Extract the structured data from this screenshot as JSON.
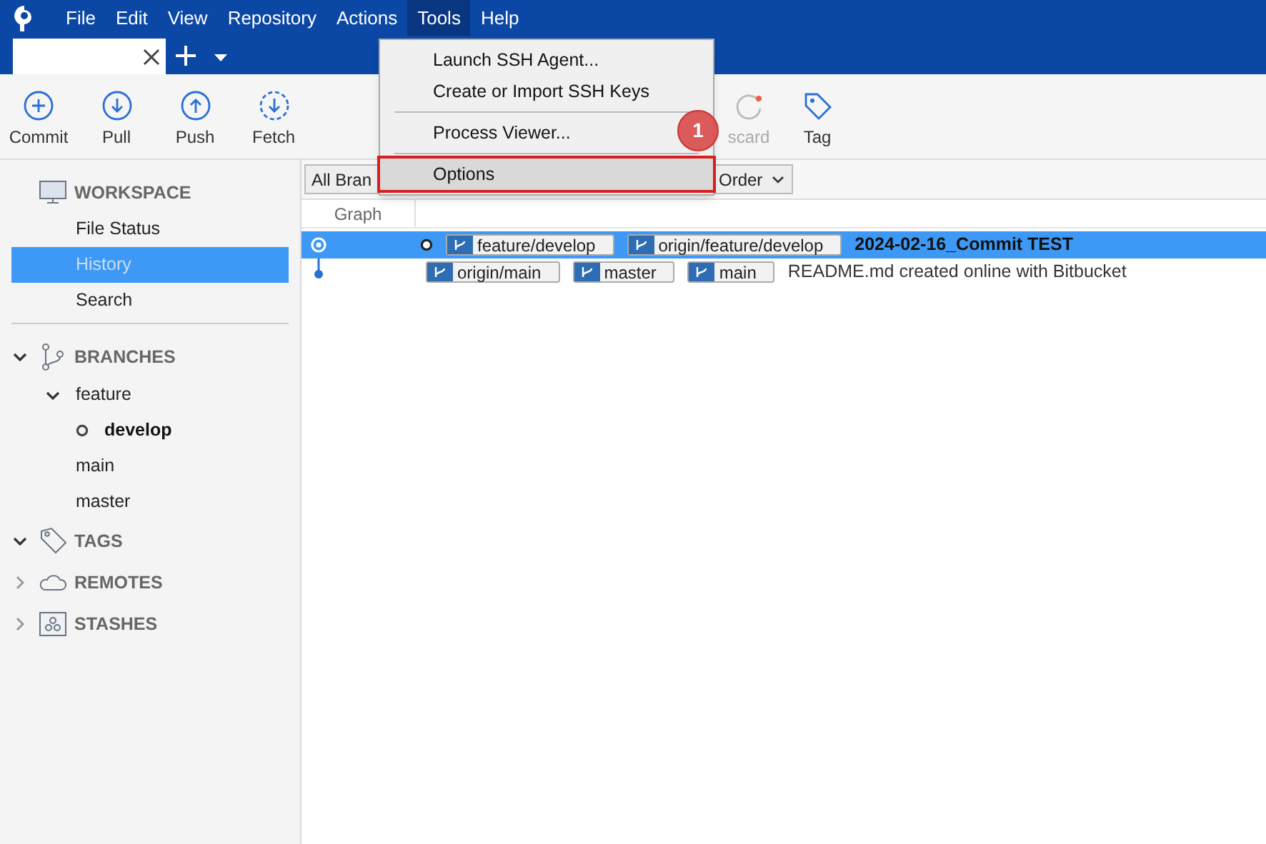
{
  "menubar": [
    {
      "label": "File",
      "selected": false
    },
    {
      "label": "Edit",
      "selected": false
    },
    {
      "label": "View",
      "selected": false
    },
    {
      "label": "Repository",
      "selected": false
    },
    {
      "label": "Actions",
      "selected": false
    },
    {
      "label": "Tools",
      "selected": true
    },
    {
      "label": "Help",
      "selected": false
    }
  ],
  "toolbar_left": [
    {
      "label": "Commit",
      "kind": "commit"
    },
    {
      "label": "Pull",
      "kind": "pull"
    },
    {
      "label": "Push",
      "kind": "push"
    },
    {
      "label": "Fetch",
      "kind": "fetch"
    }
  ],
  "toolbar_right": [
    {
      "label": "scard",
      "kind": "discard"
    },
    {
      "label": "Tag",
      "kind": "tag"
    }
  ],
  "tools_menu": {
    "groups": [
      [
        {
          "label": "Launch SSH Agent...",
          "selected": false
        },
        {
          "label": "Create or Import SSH Keys",
          "selected": false
        }
      ],
      [
        {
          "label": "Process Viewer...",
          "selected": false
        }
      ],
      [
        {
          "label": "Options",
          "selected": true
        }
      ]
    ],
    "callout": "1"
  },
  "filters": [
    {
      "label": "All Bran"
    },
    {
      "label": "Order"
    }
  ],
  "graph_header": "Graph",
  "commits": [
    {
      "selected": true,
      "head": true,
      "refs": [
        "feature/develop",
        "origin/feature/develop"
      ],
      "message": "2024-02-16_Commit TEST"
    },
    {
      "selected": false,
      "head": false,
      "refs": [
        "origin/main",
        "master",
        "main"
      ],
      "message": "README.md created online with Bitbucket"
    }
  ],
  "sidebar": {
    "workspace": {
      "title": "WORKSPACE",
      "items": [
        {
          "label": "File Status",
          "selected": false
        },
        {
          "label": "History",
          "selected": true
        },
        {
          "label": "Search",
          "selected": false
        }
      ]
    },
    "sections": [
      {
        "title": "BRANCHES",
        "kind": "branches",
        "expanded": true,
        "children": [
          {
            "label": "feature",
            "expanded": true,
            "current": false,
            "children": [
              {
                "label": "develop",
                "current": true
              }
            ]
          },
          {
            "label": "main",
            "current": false
          },
          {
            "label": "master",
            "current": false
          }
        ]
      },
      {
        "title": "TAGS",
        "kind": "tags",
        "expanded": true
      },
      {
        "title": "REMOTES",
        "kind": "remotes",
        "expanded": false
      },
      {
        "title": "STASHES",
        "kind": "stashes",
        "expanded": false
      }
    ]
  }
}
